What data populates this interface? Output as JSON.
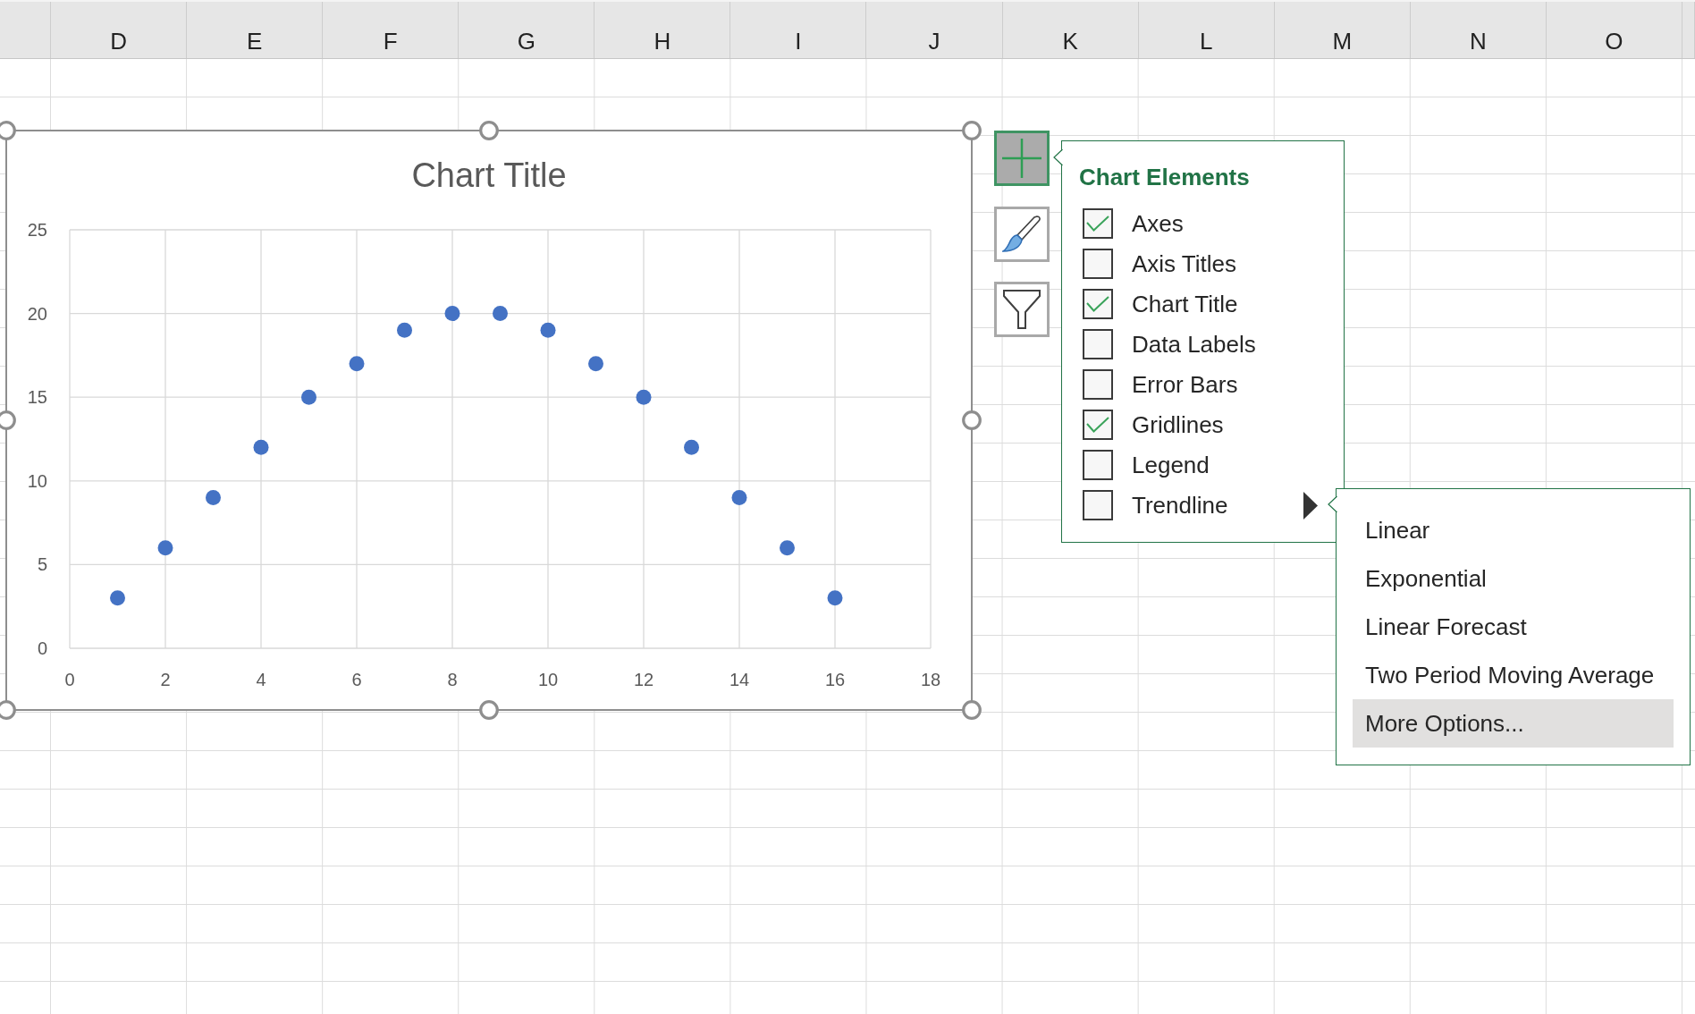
{
  "column_headers": [
    "D",
    "E",
    "F",
    "G",
    "H",
    "I",
    "J",
    "K",
    "L",
    "M",
    "N",
    "O"
  ],
  "chart": {
    "selected": true,
    "chart_data": {
      "type": "scatter",
      "title": "Chart Title",
      "x": [
        1,
        2,
        3,
        4,
        5,
        6,
        7,
        8,
        9,
        10,
        11,
        12,
        13,
        14,
        15,
        16
      ],
      "series": [
        {
          "color": "#4472c4",
          "values": [
            3,
            6,
            9,
            12,
            15,
            17,
            19,
            20,
            20,
            19,
            17,
            15,
            12,
            9,
            6,
            3
          ]
        }
      ],
      "xlim": [
        0,
        18
      ],
      "ylim": [
        0,
        25
      ],
      "xticks": [
        0,
        2,
        4,
        6,
        8,
        10,
        12,
        14,
        16,
        18
      ],
      "yticks": [
        0,
        5,
        10,
        15,
        20,
        25
      ],
      "grid": true
    }
  },
  "chart_tools": [
    {
      "kind": "elements",
      "selected": true
    },
    {
      "kind": "styles",
      "selected": false
    },
    {
      "kind": "filters",
      "selected": false
    }
  ],
  "chart_elements": {
    "title": "Chart Elements",
    "items": [
      {
        "label": "Axes",
        "checked": true
      },
      {
        "label": "Axis Titles",
        "checked": false
      },
      {
        "label": "Chart Title",
        "checked": true
      },
      {
        "label": "Data Labels",
        "checked": false
      },
      {
        "label": "Error Bars",
        "checked": false
      },
      {
        "label": "Gridlines",
        "checked": true
      },
      {
        "label": "Legend",
        "checked": false
      },
      {
        "label": "Trendline",
        "checked": false,
        "submenu": {
          "items": [
            {
              "label": "Linear",
              "selected": false
            },
            {
              "label": "Exponential",
              "selected": false
            },
            {
              "label": "Linear Forecast",
              "selected": false
            },
            {
              "label": "Two Period Moving Average",
              "selected": false
            },
            {
              "label": "More Options...",
              "selected": true
            }
          ]
        }
      }
    ]
  }
}
